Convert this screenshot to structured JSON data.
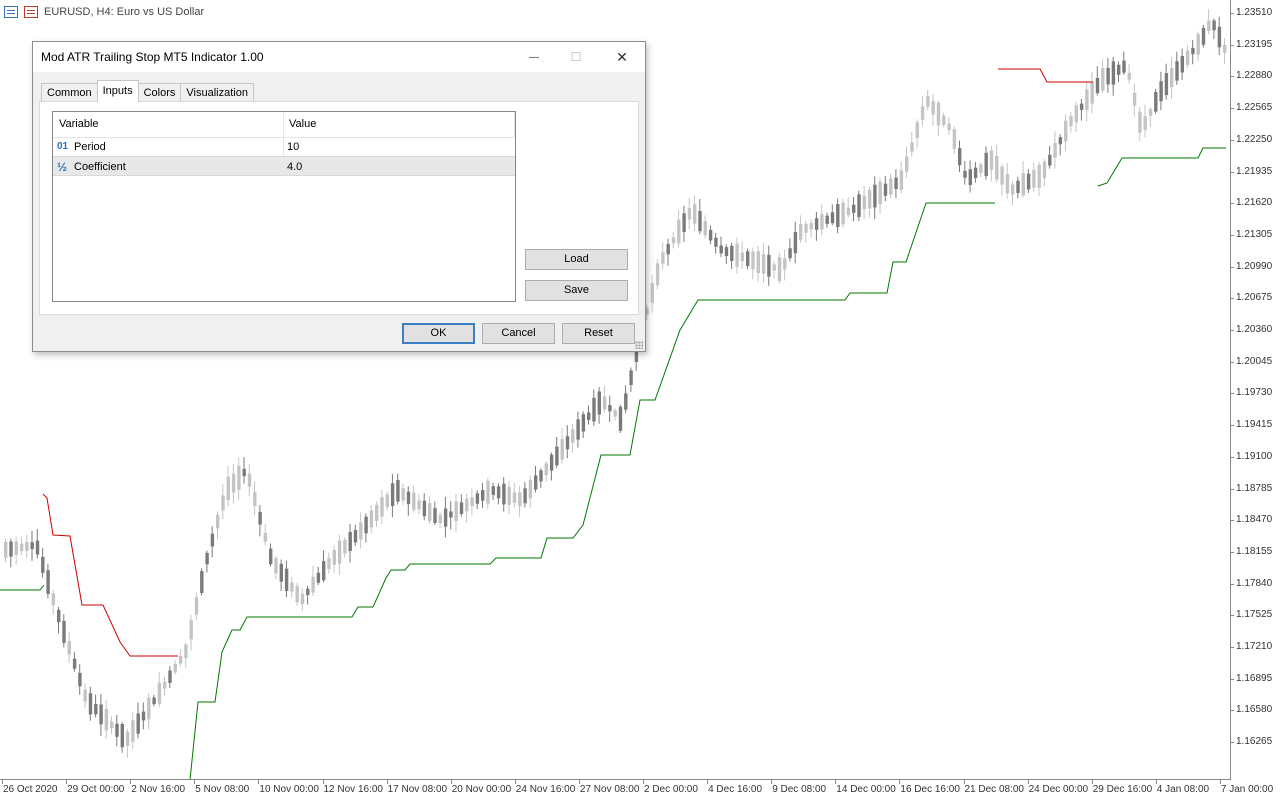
{
  "chart": {
    "symbol_text": "EURUSD, H4:  Euro vs US Dollar",
    "price_labels": [
      "1.23510",
      "1.23195",
      "1.22880",
      "1.22565",
      "1.22250",
      "1.21935",
      "1.21620",
      "1.21305",
      "1.20990",
      "1.20675",
      "1.20360",
      "1.20045",
      "1.19730",
      "1.19415",
      "1.19100",
      "1.18785",
      "1.18470",
      "1.18155",
      "1.17840",
      "1.17525",
      "1.17210",
      "1.16895",
      "1.16580",
      "1.16265"
    ],
    "date_labels": [
      "26 Oct 2020",
      "29 Oct 00:00",
      "2 Nov 16:00",
      "5 Nov 08:00",
      "10 Nov 00:00",
      "12 Nov 16:00",
      "17 Nov 08:00",
      "20 Nov 00:00",
      "24 Nov 16:00",
      "27 Nov 08:00",
      "2 Dec 00:00",
      "4 Dec 16:00",
      "9 Dec 08:00",
      "14 Dec 00:00",
      "16 Dec 16:00",
      "21 Dec 08:00",
      "24 Dec 00:00",
      "29 Dec 16:00",
      "4 Jan 08:00",
      "7 Jan 00:00"
    ],
    "colors": {
      "bull": "#c4c4c4",
      "bear": "#7a7a7a",
      "stop_up": "#007a00",
      "stop_down": "#cc0000",
      "axis": "#888888"
    }
  },
  "dialog": {
    "title": "Mod ATR Trailing Stop MT5 Indicator 1.00",
    "minimize_glyph": "—",
    "maximize_glyph": "☐",
    "close_glyph": "✕",
    "tabs": [
      "Common",
      "Inputs",
      "Colors",
      "Visualization"
    ],
    "active_tab": "Inputs",
    "columns": {
      "variable": "Variable",
      "value": "Value"
    },
    "rows": [
      {
        "icon": "01",
        "variable": "Period",
        "value": "10"
      },
      {
        "icon": "½",
        "variable": "Coefficient",
        "value": "4.0"
      }
    ],
    "buttons": {
      "load": "Load",
      "save": "Save",
      "ok": "OK",
      "cancel": "Cancel",
      "reset": "Reset"
    }
  }
}
